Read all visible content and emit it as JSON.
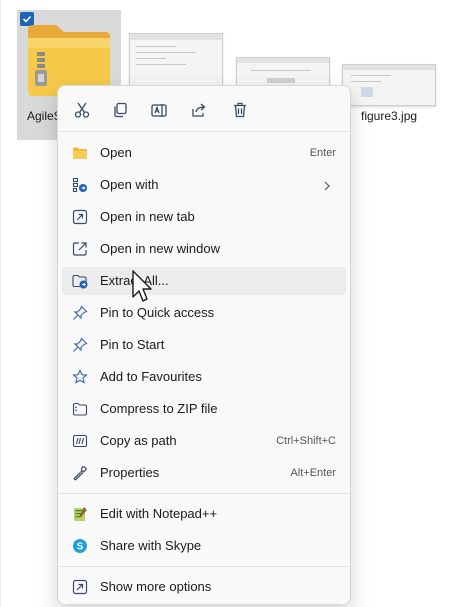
{
  "files": [
    {
      "name": "AgileS",
      "selected": true
    },
    {
      "name": "figure3.jpg",
      "selected": false
    }
  ],
  "context_menu": {
    "quick_actions": [
      {
        "name": "cut",
        "icon": "scissors-icon"
      },
      {
        "name": "copy",
        "icon": "copy-icon"
      },
      {
        "name": "rename",
        "icon": "rename-icon"
      },
      {
        "name": "share",
        "icon": "share-icon"
      },
      {
        "name": "delete",
        "icon": "trash-icon"
      }
    ],
    "items": [
      {
        "label": "Open",
        "shortcut": "Enter",
        "icon": "folder-icon"
      },
      {
        "label": "Open with",
        "shortcut": "",
        "icon": "open-with-icon",
        "has_submenu": true
      },
      {
        "label": "Open in new tab",
        "shortcut": "",
        "icon": "new-tab-icon"
      },
      {
        "label": "Open in new window",
        "shortcut": "",
        "icon": "new-window-icon"
      },
      {
        "label": "Extract All...",
        "shortcut": "",
        "icon": "extract-icon",
        "hovered": true
      },
      {
        "label": "Pin to Quick access",
        "shortcut": "",
        "icon": "pin-icon"
      },
      {
        "label": "Pin to Start",
        "shortcut": "",
        "icon": "pin-icon"
      },
      {
        "label": "Add to Favourites",
        "shortcut": "",
        "icon": "star-icon"
      },
      {
        "label": "Compress to ZIP file",
        "shortcut": "",
        "icon": "zip-icon"
      },
      {
        "label": "Copy as path",
        "shortcut": "Ctrl+Shift+C",
        "icon": "copy-path-icon"
      },
      {
        "label": "Properties",
        "shortcut": "Alt+Enter",
        "icon": "wrench-icon"
      },
      {
        "label": "Edit with Notepad++",
        "shortcut": "",
        "icon": "notepad-plus-plus-icon"
      },
      {
        "label": "Share with Skype",
        "shortcut": "",
        "icon": "skype-icon"
      },
      {
        "label": "Show more options",
        "shortcut": "",
        "icon": "more-options-icon"
      }
    ]
  },
  "colors": {
    "accent": "#1e63b5",
    "menu_bg": "#f9f9f9",
    "hover_bg": "#ececec",
    "folder_yellow": "#f5c542"
  }
}
